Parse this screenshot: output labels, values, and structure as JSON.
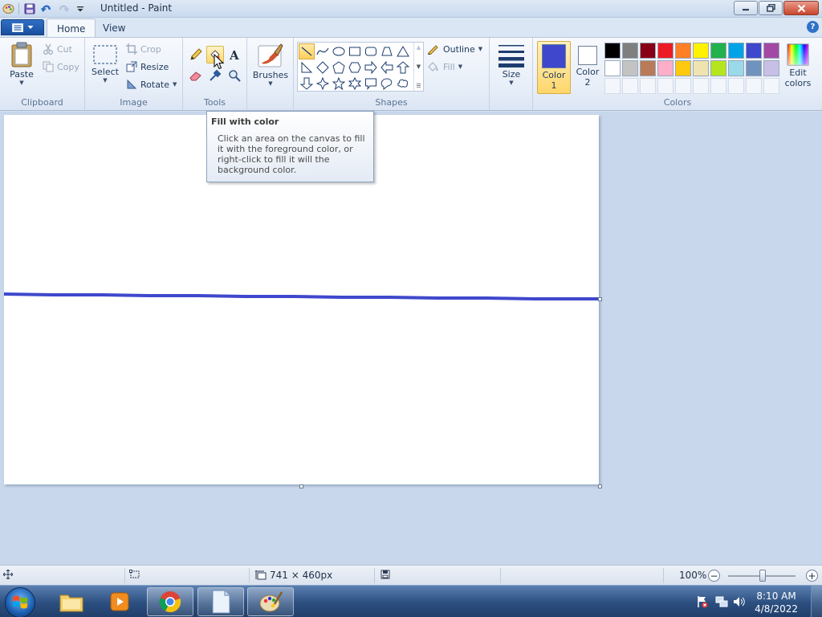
{
  "window": {
    "title": "Untitled - Paint"
  },
  "tabs": [
    {
      "label": "Home",
      "active": true
    },
    {
      "label": "View",
      "active": false
    }
  ],
  "ribbon": {
    "clipboard": {
      "paste_label": "Paste",
      "cut_label": "Cut",
      "copy_label": "Copy",
      "group_label": "Clipboard"
    },
    "image": {
      "select_label": "Select",
      "crop_label": "Crop",
      "resize_label": "Resize",
      "rotate_label": "Rotate",
      "group_label": "Image"
    },
    "tools": {
      "group_label": "Tools",
      "items": [
        "pencil-icon",
        "fill-bucket-icon",
        "text-icon",
        "eraser-icon",
        "color-picker-icon",
        "magnifier-icon"
      ]
    },
    "brushes": {
      "label": "Brushes"
    },
    "shapes": {
      "outline_label": "Outline",
      "fill_label": "Fill",
      "group_label": "Shapes"
    },
    "size": {
      "label": "Size"
    },
    "colors": {
      "color1_label": "Color\n1",
      "color1_line1": "Color",
      "color1_line2": "1",
      "color2_line1": "Color",
      "color2_line2": "2",
      "edit_line1": "Edit",
      "edit_line2": "colors",
      "group_label": "Colors",
      "color1_value": "#3f48cc",
      "color2_value": "#ffffff",
      "palette_row1": [
        "#000000",
        "#7f7f7f",
        "#880015",
        "#ed1c24",
        "#ff7f27",
        "#fff200",
        "#22b14c",
        "#00a2e8",
        "#3f48cc",
        "#a349a4"
      ],
      "palette_row2": [
        "#ffffff",
        "#c3c3c3",
        "#b97a57",
        "#ffaec9",
        "#ffc90e",
        "#efe4b0",
        "#b5e61d",
        "#99d9ea",
        "#7092be",
        "#c8bfe7"
      ]
    }
  },
  "tooltip": {
    "title": "Fill with color",
    "body": "Click an area on the canvas to fill it with the foreground color, or right-click to fill it will the background color."
  },
  "statusbar": {
    "canvas_size": "741 × 460px",
    "zoom": "100%",
    "zoom_fraction": 0.5
  },
  "taskbar": {
    "time": "8:10 AM",
    "date": "4/8/2022"
  }
}
